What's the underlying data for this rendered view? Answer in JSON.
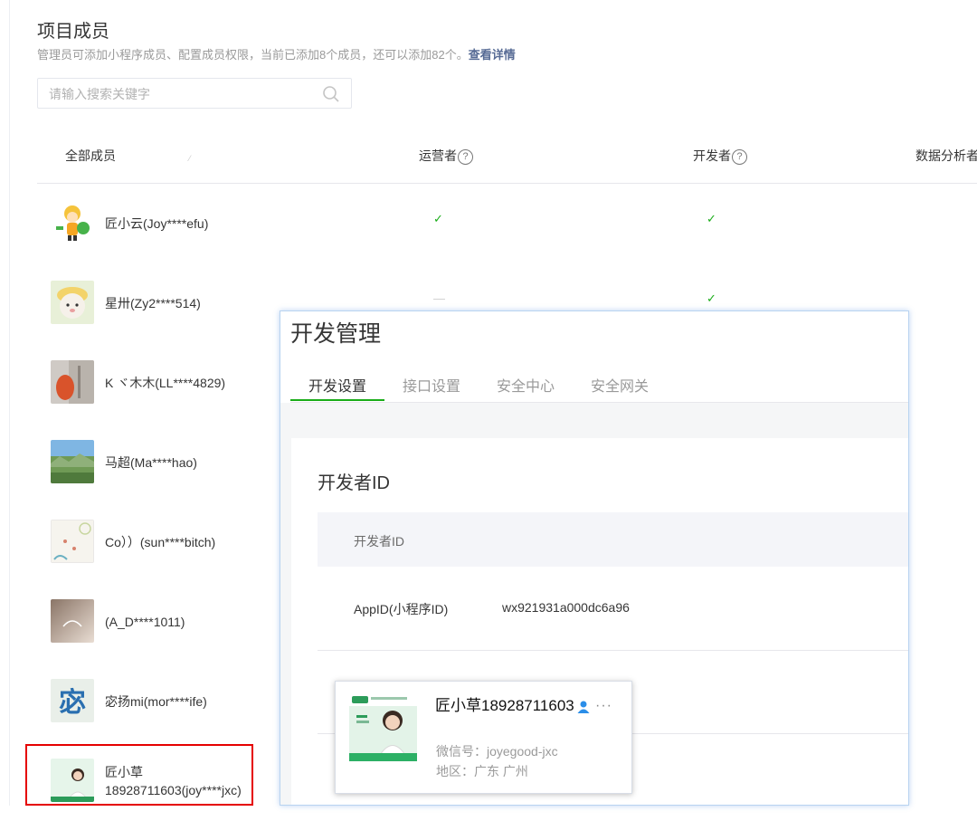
{
  "header": {
    "title": "项目成员",
    "subtitle": "管理员可添加小程序成员、配置成员权限，当前已添加8个成员，还可以添加82个。",
    "subtitle_link": "查看详情"
  },
  "search": {
    "placeholder": "请输入搜索关键字",
    "value": ""
  },
  "table": {
    "columns": [
      "全部成员",
      "运营者",
      "开发者",
      "数据分析者"
    ],
    "rows": [
      {
        "name": "匠小云(Joy****efu)",
        "operator": "check",
        "developer": "check"
      },
      {
        "name": "星卅(Zy2****514)",
        "operator": "dash",
        "developer": "check"
      },
      {
        "name": "K ヾ木木(LL****4829)"
      },
      {
        "name": "马超(Ma****hao)"
      },
      {
        "name": "Co））(sun****bitch)"
      },
      {
        "name": "(A_D****1011)"
      },
      {
        "name": "宓扬mi(mor****ife)"
      },
      {
        "name": "匠小草18928711603(joy****jxc)"
      }
    ],
    "check_glyph": "✓",
    "dash_glyph": "—"
  },
  "dev_panel": {
    "title": "开发管理",
    "tabs": [
      "开发设置",
      "接口设置",
      "安全中心",
      "安全网关"
    ],
    "active_tab": 0,
    "section_title": "开发者ID",
    "table_header": "开发者ID",
    "appid_label": "AppID(小程序ID)",
    "appid_value": "wx921931a000dc6a96"
  },
  "profile_popup": {
    "name": "匠小草18928711603",
    "wechat": "微信号：joyegood-jxc",
    "region": "地区：广东 广州",
    "more": "···"
  },
  "colors": {
    "accent_green": "#1aad19",
    "link_blue": "#576b95",
    "highlight_red": "#e50000"
  }
}
